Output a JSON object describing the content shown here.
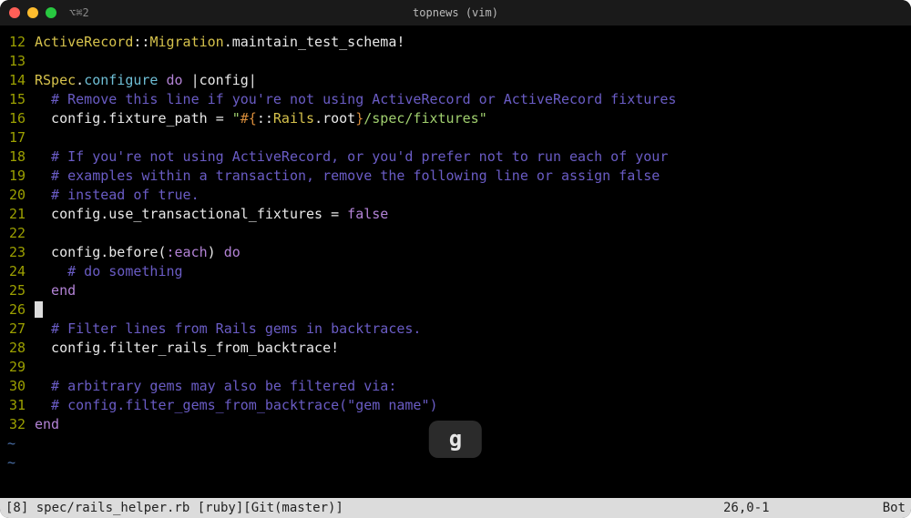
{
  "window": {
    "tab_label": "⌥⌘2",
    "title": "topnews (vim)"
  },
  "gutter": {
    "12": "12",
    "13": "13",
    "14": "14",
    "15": "15",
    "16": "16",
    "17": "17",
    "18": "18",
    "19": "19",
    "20": "20",
    "21": "21",
    "22": "22",
    "23": "23",
    "24": "24",
    "25": "25",
    "26": "26",
    "27": "27",
    "28": "28",
    "29": "29",
    "30": "30",
    "31": "31",
    "32": "32"
  },
  "code": {
    "l12": {
      "a": "ActiveRecord",
      "b": "::",
      "c": "Migration",
      "d": ".maintain_test_schema!"
    },
    "l14": {
      "a": "RSpec",
      "b": ".",
      "c": "configure",
      "d": " do ",
      "e": "|config|"
    },
    "l15": "  # Remove this line if you're not using ActiveRecord or ActiveRecord fixtures",
    "l16": {
      "a": "  config.fixture_path ",
      "b": "= ",
      "c": "\"",
      "d": "#{",
      "e": "::",
      "f": "Rails",
      "g": ".root",
      "h": "}",
      "i": "/spec/fixtures",
      "j": "\""
    },
    "l18": "  # If you're not using ActiveRecord, or you'd prefer not to run each of your",
    "l19": "  # examples within a transaction, remove the following line or assign false",
    "l20": "  # instead of true.",
    "l21": {
      "a": "  config.use_transactional_fixtures ",
      "b": "= ",
      "c": "false"
    },
    "l23": {
      "a": "  config.before(",
      "b": ":each",
      "c": ") ",
      "d": "do"
    },
    "l24": "    # do something",
    "l25": "  end",
    "l27": "  # Filter lines from Rails gems in backtraces.",
    "l28": "  config.filter_rails_from_backtrace!",
    "l30": "  # arbitrary gems may also be filtered via:",
    "l31": "  # config.filter_gems_from_backtrace(\"gem name\")",
    "l32": "end"
  },
  "tilde": "~",
  "status": {
    "left": "[8] spec/rails_helper.rb [ruby][Git(master)]",
    "pos": "26,0-1",
    "right": "Bot"
  },
  "overlay": "g"
}
